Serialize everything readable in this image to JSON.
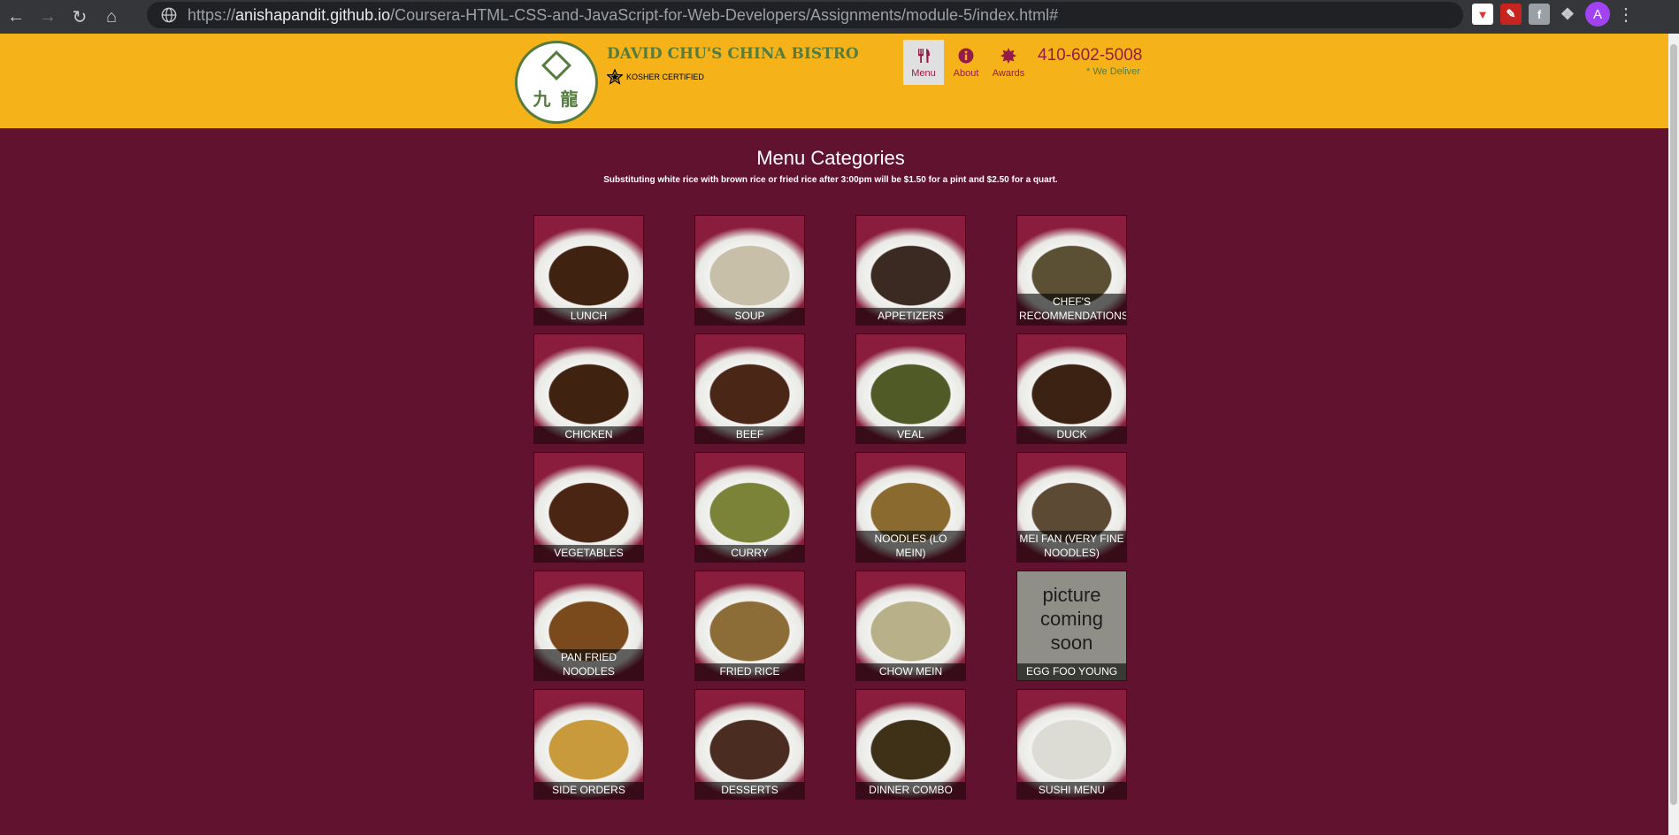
{
  "browser": {
    "url_scheme": "https://",
    "url_host": "anishapandit.github.io",
    "url_path": "/Coursera-HTML-CSS-and-JavaScript-for-Web-Developers/Assignments/module-5/index.html#",
    "profile_initial": "A"
  },
  "header": {
    "logo_chars": "九 龍",
    "brand_name": "DAVID CHU'S CHINA BISTRO",
    "kosher": "KOSHER CERTIFIED",
    "nav": [
      {
        "label": "Menu",
        "icon": "cutlery-icon"
      },
      {
        "label": "About",
        "icon": "info-icon"
      },
      {
        "label": "Awards",
        "icon": "certificate-icon"
      }
    ],
    "phone": "410-602-5008",
    "deliver": "* We Deliver"
  },
  "main": {
    "title": "Menu Categories",
    "subtitle": "Substituting white rice with brown rice or fried rice after 3:00pm will be $1.50 for a pint and $2.50 for a quart.",
    "categories": [
      {
        "name": "LUNCH",
        "color": "#3f2210"
      },
      {
        "name": "SOUP",
        "color": "#c8bfa8"
      },
      {
        "name": "APPETIZERS",
        "color": "#3b2a21"
      },
      {
        "name": "CHEF'S RECOMMENDATIONS",
        "color": "#5c5034"
      },
      {
        "name": "CHICKEN",
        "color": "#3f2210"
      },
      {
        "name": "BEEF",
        "color": "#4a2616"
      },
      {
        "name": "VEAL",
        "color": "#4f5a26"
      },
      {
        "name": "DUCK",
        "color": "#3b2213"
      },
      {
        "name": "VEGETABLES",
        "color": "#4b2514"
      },
      {
        "name": "CURRY",
        "color": "#7b8338"
      },
      {
        "name": "NOODLES (LO MEIN)",
        "color": "#8a6a2e"
      },
      {
        "name": "MEI FAN (VERY FINE NOODLES)",
        "color": "#5d4a35"
      },
      {
        "name": "PAN FRIED NOODLES",
        "color": "#7a4a1c"
      },
      {
        "name": "FRIED RICE",
        "color": "#8d6d37"
      },
      {
        "name": "CHOW MEIN",
        "color": "#b8b089"
      },
      {
        "name": "EGG FOO YOUNG",
        "color": "#8f8f88",
        "placeholder": "picture coming soon"
      },
      {
        "name": "SIDE ORDERS",
        "color": "#c99a3b"
      },
      {
        "name": "DESSERTS",
        "color": "#4a2d20"
      },
      {
        "name": "DINNER COMBO",
        "color": "#3f3018"
      },
      {
        "name": "SUSHI MENU",
        "color": "#dcdcd5"
      }
    ]
  }
}
